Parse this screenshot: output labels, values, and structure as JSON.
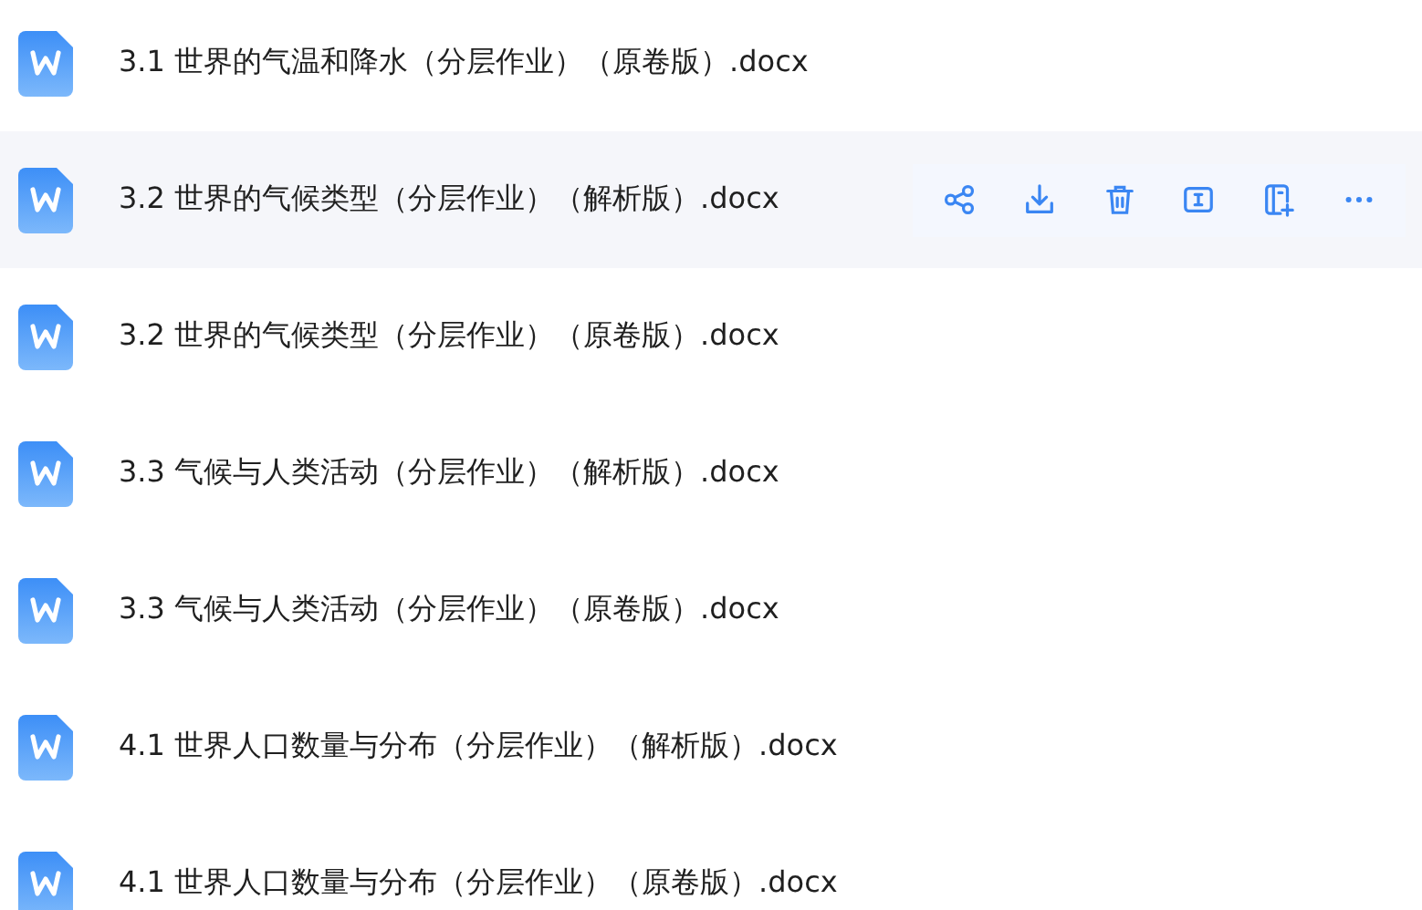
{
  "files": [
    {
      "name": "3.1 世界的气温和降水（分层作业）（原卷版）.docx",
      "selected": false
    },
    {
      "name": "3.2 世界的气候类型（分层作业）（解析版）.docx",
      "selected": true
    },
    {
      "name": "3.2 世界的气候类型（分层作业）（原卷版）.docx",
      "selected": false
    },
    {
      "name": "3.3 气候与人类活动（分层作业）（解析版）.docx",
      "selected": false
    },
    {
      "name": "3.3 气候与人类活动（分层作业）（原卷版）.docx",
      "selected": false
    },
    {
      "name": "4.1 世界人口数量与分布（分层作业）（解析版）.docx",
      "selected": false
    },
    {
      "name": "4.1 世界人口数量与分布（分层作业）（原卷版）.docx",
      "selected": false
    }
  ]
}
